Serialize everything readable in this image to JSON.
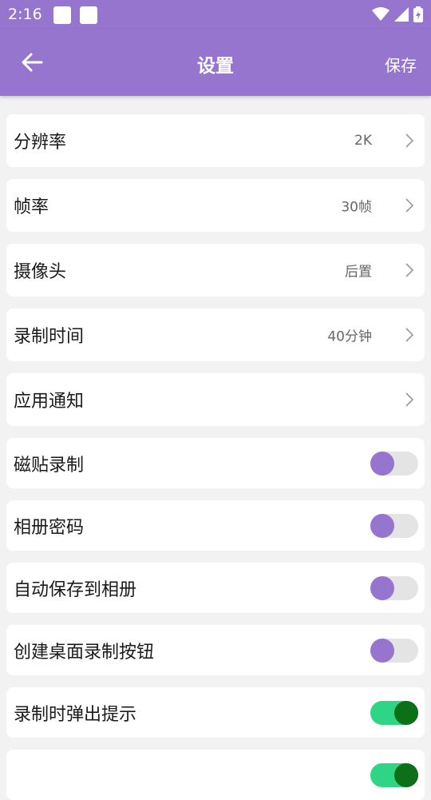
{
  "status": {
    "time": "2:16"
  },
  "appbar": {
    "title": "设置",
    "save_label": "保存"
  },
  "rows": [
    {
      "label": "分辨率",
      "value": "2K"
    },
    {
      "label": "帧率",
      "value": "30帧"
    },
    {
      "label": "摄像头",
      "value": "后置"
    },
    {
      "label": "录制时间",
      "value": "40分钟"
    },
    {
      "label": "应用通知",
      "value": ""
    }
  ],
  "toggles": [
    {
      "label": "磁贴录制",
      "state": "off"
    },
    {
      "label": "相册密码",
      "state": "off"
    },
    {
      "label": "自动保存到相册",
      "state": "off"
    },
    {
      "label": "创建桌面录制按钮",
      "state": "off"
    },
    {
      "label": "录制时弹出提示",
      "state": "on"
    },
    {
      "label": "",
      "state": "on"
    }
  ],
  "colors": {
    "accent": "#9575cd",
    "toggle_on_track": "#2ed584",
    "toggle_on_knob": "#0d6f18",
    "toggle_off_track": "#e4e4e4"
  }
}
